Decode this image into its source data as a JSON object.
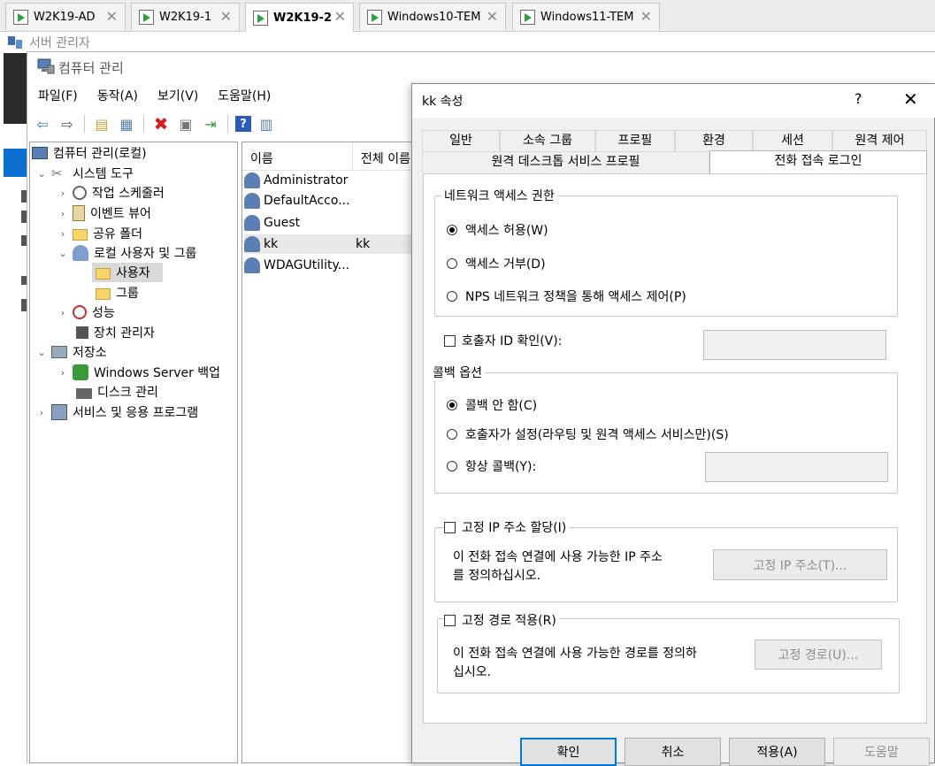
{
  "vm_tabs": [
    {
      "label": "W2K19-AD",
      "active": false
    },
    {
      "label": "W2K19-1",
      "active": false
    },
    {
      "label": "W2K19-2",
      "active": true
    },
    {
      "label": "Windows10-TEM",
      "active": false
    },
    {
      "label": "Windows11-TEM",
      "active": false
    }
  ],
  "server_manager": {
    "title": "서버 관리자"
  },
  "window": {
    "title": "컴퓨터 관리",
    "menu": [
      "파일(F)",
      "동작(A)",
      "보기(V)",
      "도움말(H)"
    ]
  },
  "tree": {
    "root": "컴퓨터 관리(로컬)",
    "system_tools": "시스템 도구",
    "task_scheduler": "작업 스케줄러",
    "event_viewer": "이벤트 뷰어",
    "shared_folders": "공유 폴더",
    "local_users_groups": "로컬 사용자 및 그룹",
    "users": "사용자",
    "groups": "그룹",
    "performance": "성능",
    "device_manager": "장치 관리자",
    "storage": "저장소",
    "windows_server_backup": "Windows Server 백업",
    "disk_management": "디스크 관리",
    "services_apps": "서비스 및 응용 프로그램"
  },
  "list": {
    "col_name": "이름",
    "col_fullname": "전체 이름",
    "rows": [
      {
        "name": "Administrator",
        "fullname": ""
      },
      {
        "name": "DefaultAcco...",
        "fullname": ""
      },
      {
        "name": "Guest",
        "fullname": ""
      },
      {
        "name": "kk",
        "fullname": "kk"
      },
      {
        "name": "WDAGUtility...",
        "fullname": ""
      }
    ]
  },
  "dialog": {
    "title": "kk 속성",
    "help": "?",
    "close": "✕",
    "tabs_row1": [
      "일반",
      "소속 그룹",
      "프로필",
      "환경",
      "세션",
      "원격 제어"
    ],
    "tabs_row2": [
      "원격 데스크톱 서비스 프로필",
      "전화 접속 로그인"
    ],
    "network_access": {
      "legend": "네트워크 액세스 권한",
      "allow": "액세스 허용(W)",
      "deny": "액세스 거부(D)",
      "nps": "NPS 네트워크 정책을 통해 액세스 제어(P)"
    },
    "caller_id": "호출자 ID 확인(V):",
    "callback": {
      "legend": "콜백 옵션",
      "none": "콜백 안 함(C)",
      "caller_set": "호출자가 설정(라우팅 및 원격 액세스 서비스만)(S)",
      "always": "항상 콜백(Y):"
    },
    "static_ip": {
      "check_label": "고정 IP 주소 할당(I)",
      "desc_line1": "이 전화 접속 연결에 사용 가능한 IP 주소",
      "desc_line2": "를 정의하십시오.",
      "button": "고정 IP 주소(T)..."
    },
    "static_routes": {
      "check_label": "고정 경로 적용(R)",
      "desc_line1": "이 전화 접속 연결에 사용 가능한 경로를 정의하",
      "desc_line2": "십시오.",
      "button": "고정 경로(U)..."
    },
    "buttons": {
      "ok": "확인",
      "cancel": "취소",
      "apply": "적용(A)",
      "help": "도움말"
    }
  }
}
